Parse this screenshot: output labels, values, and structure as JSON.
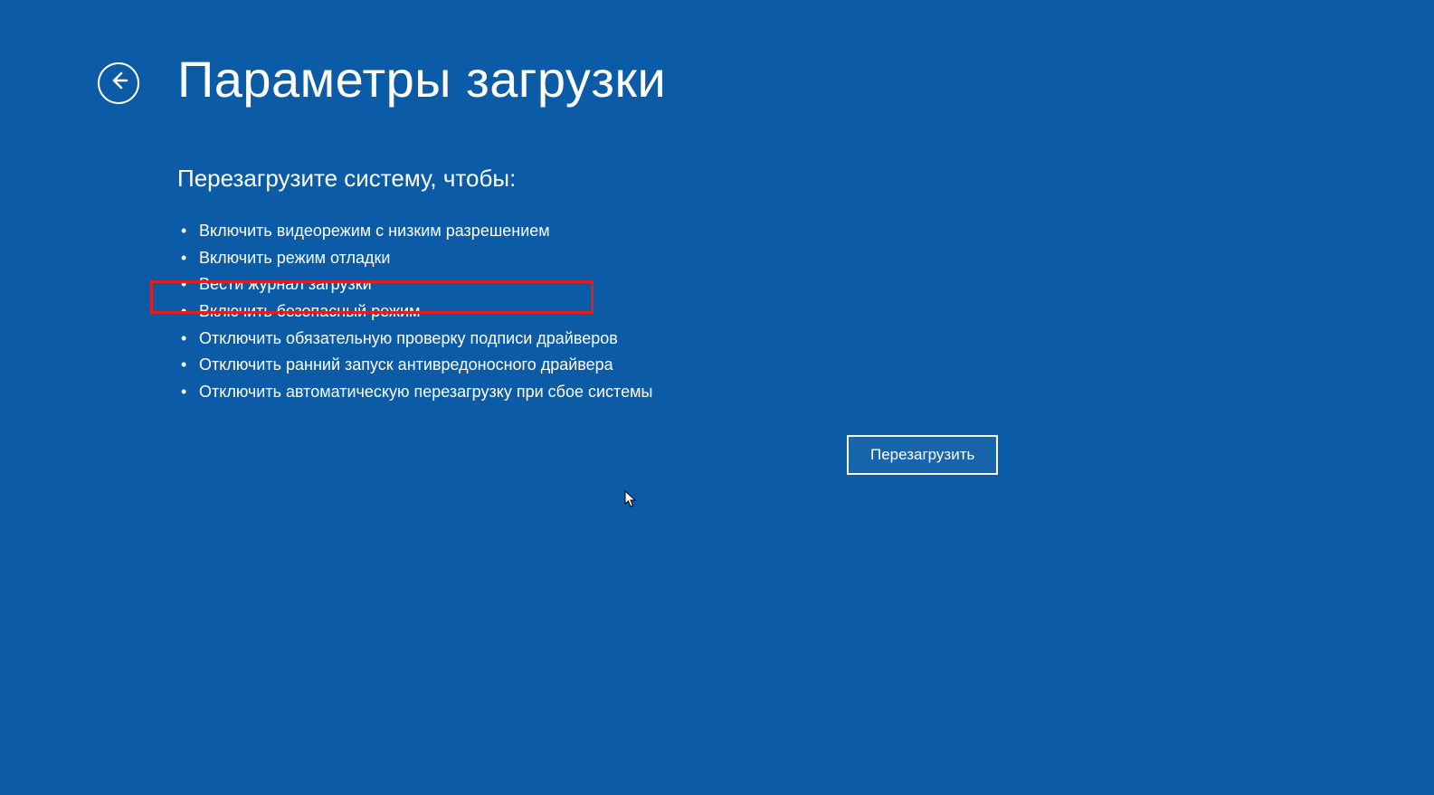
{
  "title": "Параметры загрузки",
  "subtitle": "Перезагрузите систему, чтобы:",
  "options": [
    "Включить видеорежим с низким разрешением",
    "Включить режим отладки",
    "Вести журнал загрузки",
    "Включить безопасный режим",
    "Отключить обязательную проверку подписи драйверов",
    "Отключить ранний запуск антивредоносного драйвера",
    "Отключить автоматическую перезагрузку при сбое системы"
  ],
  "highlighted_option_index": 3,
  "restart_button_label": "Перезагрузить",
  "colors": {
    "background": "#0b5ba6",
    "text": "#ffffff",
    "highlight_border": "#e02020",
    "button_bg": "#1865ac"
  }
}
